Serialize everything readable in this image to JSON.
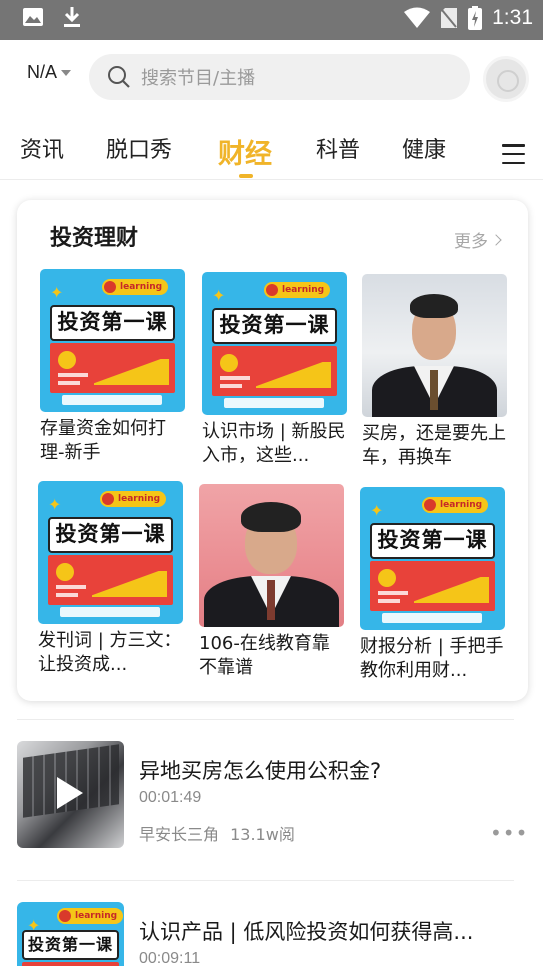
{
  "status_bar": {
    "time": "1:31"
  },
  "header": {
    "region": "N/A",
    "search_placeholder": "搜索节目/主播"
  },
  "tabs": [
    "资讯",
    "脱口秀",
    "财经",
    "科普",
    "健康"
  ],
  "active_tab": "财经",
  "section": {
    "title": "投资理财",
    "more": "更多",
    "tiles": [
      {
        "title": "存量资金如何打理-新手",
        "cover": "course",
        "cover_title": "投资第一课",
        "cover_badge": "learning"
      },
      {
        "title": "认识市场 | 新股民入市，这些...",
        "cover": "course",
        "cover_title": "投资第一课",
        "cover_badge": "learning"
      },
      {
        "title": "买房，还是要先上车，再换车",
        "cover": "person"
      },
      {
        "title": "发刊词 | 方三文：让投资成...",
        "cover": "course",
        "cover_title": "投资第一课",
        "cover_badge": "learning"
      },
      {
        "title": "106-在线教育靠不靠谱",
        "cover": "person"
      },
      {
        "title": "财报分析 | 手把手教你利用财...",
        "cover": "course",
        "cover_title": "投资第一课",
        "cover_badge": "learning"
      }
    ]
  },
  "list": [
    {
      "title": "异地买房怎么使用公积金?",
      "duration": "00:01:49",
      "author": "早安长三角",
      "views": "13.1w阅"
    },
    {
      "title": "认识产品 | 低风险投资如何获得高...",
      "duration": "00:09:11",
      "cover_title": "投资第一课",
      "cover_badge": "learning"
    }
  ],
  "colors": {
    "accent": "#f0b429",
    "cover_blue": "#36b6e8",
    "cover_red": "#e8423a"
  }
}
